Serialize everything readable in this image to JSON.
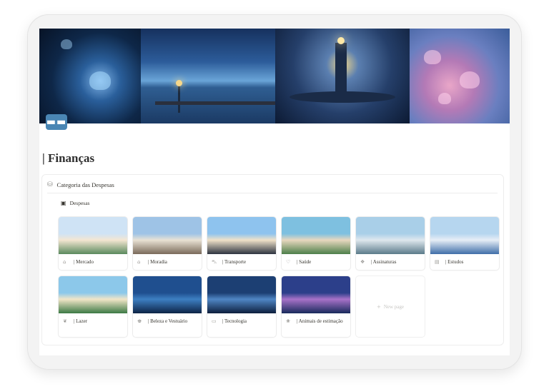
{
  "page": {
    "icon": "credit-card-icon",
    "icon_glyph": "▬▬",
    "title": "| Finanças"
  },
  "database": {
    "icon": "wallet-icon",
    "icon_glyph": "⛁",
    "title": "Categoria das Despesas",
    "view": {
      "icon": "money-icon",
      "icon_glyph": "▣",
      "label": "Despesas"
    }
  },
  "cards": [
    {
      "label": "| Mercado",
      "icon": "cart-icon",
      "glyph": "⌂",
      "colors": [
        "#cfe3f5",
        "#f4e6d2",
        "#5a8a5d"
      ]
    },
    {
      "label": "| Moradia",
      "icon": "house-icon",
      "glyph": "⌂",
      "colors": [
        "#9ec3e6",
        "#e9e2d4",
        "#7a6a5a"
      ]
    },
    {
      "label": "| Transporte",
      "icon": "car-icon",
      "glyph": "⛍",
      "colors": [
        "#8ec3ee",
        "#f0e2c9",
        "#2d3440"
      ]
    },
    {
      "label": "| Saúde",
      "icon": "heart-icon",
      "glyph": "♡",
      "colors": [
        "#7ec0e0",
        "#e8d8bf",
        "#4d7f4a"
      ]
    },
    {
      "label": "| Assinaturas",
      "icon": "receipt-icon",
      "glyph": "❖",
      "colors": [
        "#a9cfe8",
        "#dfe8ee",
        "#5b7b8a"
      ]
    },
    {
      "label": "| Estudos",
      "icon": "book-icon",
      "glyph": "▤",
      "colors": [
        "#b6d6ef",
        "#e7eef6",
        "#3f6ea8"
      ]
    },
    {
      "label": "| Lazer",
      "icon": "leaf-icon",
      "glyph": "❦",
      "colors": [
        "#8cc8ea",
        "#f2e6c8",
        "#3c7a45"
      ]
    },
    {
      "label": "| Beleza e Vestuário",
      "icon": "shirt-icon",
      "glyph": "♚",
      "colors": [
        "#1f4f8f",
        "#3d7fc2",
        "#0d2446"
      ]
    },
    {
      "label": "| Tecnologia",
      "icon": "laptop-icon",
      "glyph": "▭",
      "colors": [
        "#1c3f73",
        "#4f86c4",
        "#0d1f3d"
      ]
    },
    {
      "label": "| Animais de estimação",
      "icon": "cat-icon",
      "glyph": "❀",
      "colors": [
        "#2c3f8a",
        "#a772c9",
        "#182a5c"
      ]
    }
  ],
  "new_page": {
    "label": "New page",
    "icon": "plus-icon",
    "glyph": "+"
  }
}
